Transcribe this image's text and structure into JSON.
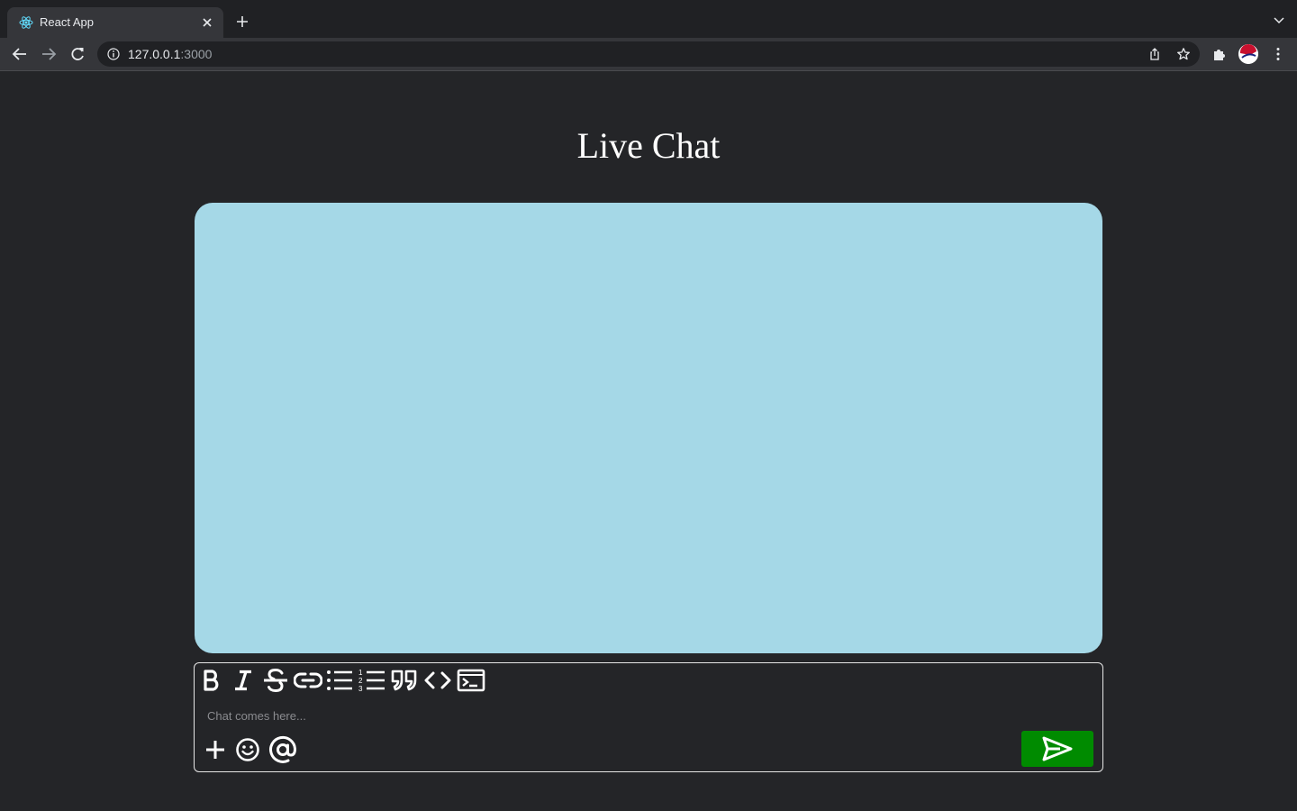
{
  "browser": {
    "tab": {
      "title": "React App",
      "favicon": "react-logo-icon"
    },
    "url": {
      "host": "127.0.0.1",
      "port": ":3000"
    }
  },
  "page": {
    "title": "Live Chat"
  },
  "composer": {
    "placeholder": "Chat comes here...",
    "format_tools": [
      "bold-icon",
      "italic-icon",
      "strikethrough-icon",
      "link-icon",
      "bullet-list-icon",
      "numbered-list-icon",
      "quote-icon",
      "code-icon",
      "code-block-icon"
    ],
    "actions": [
      "plus-icon",
      "emoji-icon",
      "mention-icon"
    ],
    "send_icon": "send-icon"
  },
  "colors": {
    "background": "#242528",
    "chat_area": "#a5d8e7",
    "send_button": "#008b00"
  }
}
